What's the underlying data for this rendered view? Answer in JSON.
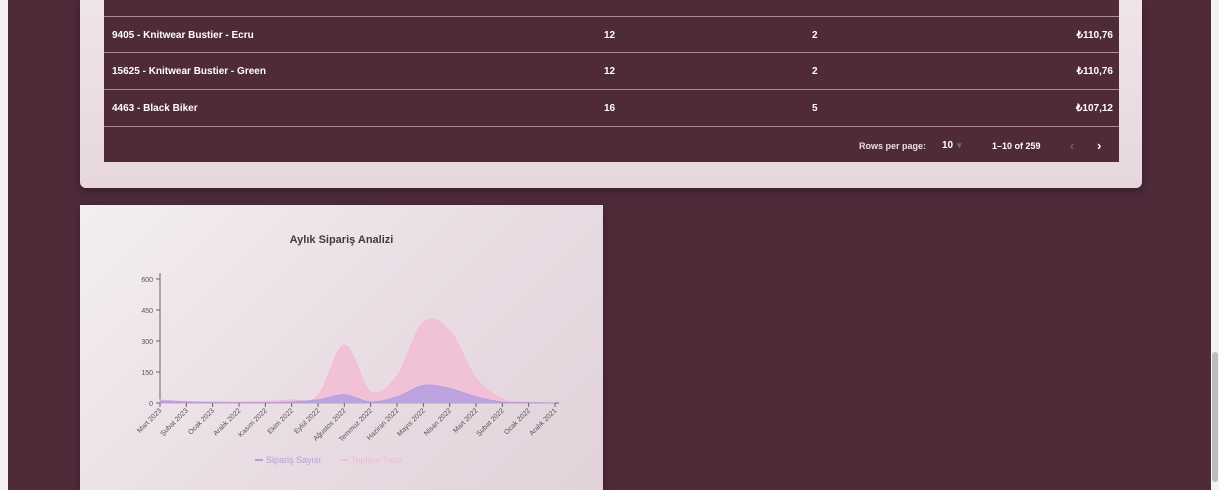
{
  "table": {
    "rows": [
      {
        "product": "9405 - Knitwear Bustier - Ecru",
        "qty": "12",
        "count": "2",
        "price": "₺110,76"
      },
      {
        "product": "15625 - Knitwear Bustier - Green",
        "qty": "12",
        "count": "2",
        "price": "₺110,76"
      },
      {
        "product": "4463 - Black Biker",
        "qty": "16",
        "count": "5",
        "price": "₺107,12"
      }
    ],
    "pagination": {
      "rows_per_page_label": "Rows per page:",
      "rows_per_page_value": "10",
      "range": "1–10 of 259"
    }
  },
  "chart_data": {
    "type": "area",
    "title": "Aylık Sipariş Analizi",
    "categories": [
      "Mart 2023",
      "Şubat 2023",
      "Ocak 2023",
      "Aralık 2022",
      "Kasım 2022",
      "Ekim 2022",
      "Eylül 2022",
      "Ağustos 2022",
      "Temmuz 2022",
      "Haziran 2022",
      "Mayıs 2022",
      "Nisan 2022",
      "Mart 2022",
      "Şubat 2022",
      "Ocak 2022",
      "Aralık 2021"
    ],
    "y_ticks": [
      0,
      150,
      300,
      450,
      600
    ],
    "ylim": [
      0,
      600
    ],
    "series": [
      {
        "name": "Sipariş Sayısı",
        "color": "#b49ee0",
        "values": [
          10,
          5,
          3,
          2,
          2,
          5,
          15,
          40,
          5,
          30,
          85,
          70,
          30,
          5,
          2,
          0
        ]
      },
      {
        "name": "Toplam Tutar",
        "color": "#f2bcd4",
        "values": [
          15,
          8,
          5,
          5,
          8,
          15,
          35,
          280,
          55,
          130,
          390,
          350,
          120,
          20,
          5,
          0
        ]
      }
    ],
    "legend_position": "bottom"
  }
}
